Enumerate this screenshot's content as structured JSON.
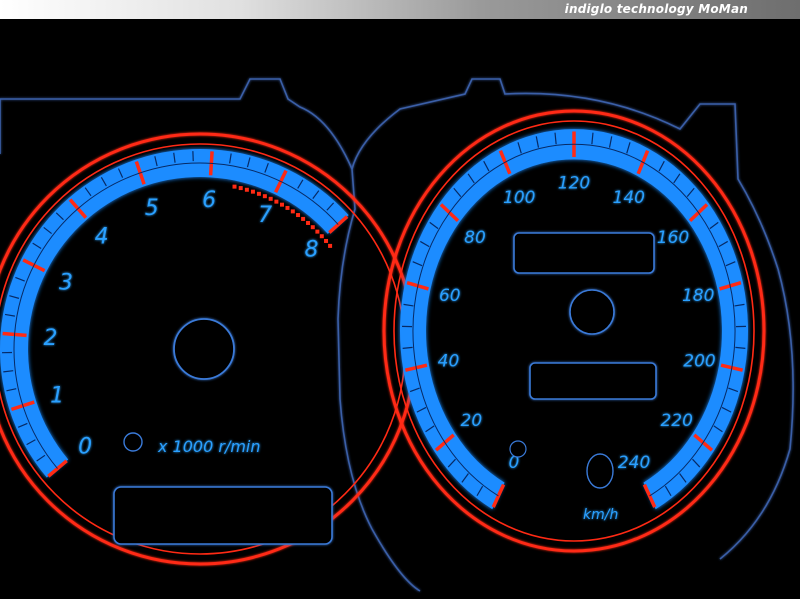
{
  "banner": {
    "text": "indiglo technology",
    "brand": "MoMan"
  },
  "tachometer": {
    "labels": [
      "0",
      "1",
      "2",
      "3",
      "4",
      "5",
      "6",
      "7",
      "8"
    ],
    "unit": "x 1000 r/min"
  },
  "speedometer": {
    "labels": [
      "0",
      "20",
      "40",
      "60",
      "80",
      "100",
      "120",
      "140",
      "160",
      "180",
      "200",
      "220",
      "240"
    ],
    "unit": "km/h"
  },
  "colors": {
    "glow_blue": "#2aa0ff",
    "band_blue": "#1e8cff",
    "ring_red": "#ff2a14",
    "outline_blue": "#3a7ad8",
    "background": "#000000"
  }
}
